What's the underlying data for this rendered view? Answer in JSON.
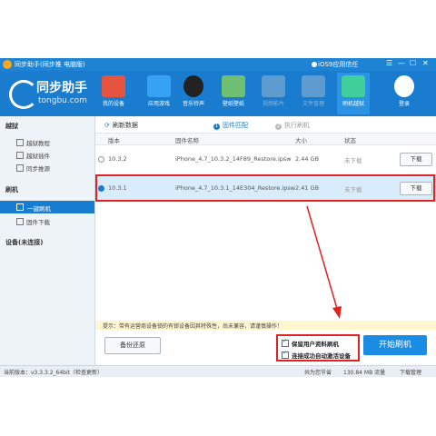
{
  "window": {
    "title": "同步助手(同步推 电脑版)",
    "ios9_link": "iOS9应用信任",
    "controls": [
      "☰",
      "—",
      "☐",
      "✕"
    ]
  },
  "brand": {
    "name_cn": "同步助手",
    "name_en": "tongbu.com"
  },
  "nav": [
    {
      "label": "我的设备",
      "icon": "store-icon",
      "color": "#e5543f",
      "active": false
    },
    {
      "label": "应用游戏",
      "icon": "app-store-icon",
      "color": "#36a3f2",
      "active": false
    },
    {
      "label": "音乐铃声",
      "icon": "music-disc-icon",
      "color": "#222222",
      "active": false
    },
    {
      "label": "壁纸壁纸",
      "icon": "wallpaper-icon",
      "color": "#6fbf73",
      "active": false
    },
    {
      "label": "视频影片",
      "icon": "video-icon",
      "color": "#8fb8dd",
      "active": false
    },
    {
      "label": "文件管理",
      "icon": "folder-icon",
      "color": "#8fb8dd",
      "active": false
    },
    {
      "label": "刷机越狱",
      "icon": "flash-icon",
      "color": "#3fcf9a",
      "active": true
    },
    {
      "label": "登录",
      "icon": "user-icon",
      "color": "#ffffff",
      "active": false
    }
  ],
  "sidebar": {
    "sections": [
      {
        "title": "越狱",
        "items": [
          "越狱教程",
          "越狱插件",
          "同步推源"
        ]
      },
      {
        "title": "刷机",
        "items": [
          "一键刷机",
          "固件下载"
        ]
      },
      {
        "title": "设备(未连接)",
        "items": []
      }
    ],
    "active_item": "一键刷机"
  },
  "toolbar": {
    "refresh_label": "刷新数据",
    "step1": "固件匹配",
    "step2": "执行刷机"
  },
  "table": {
    "columns": [
      "版本",
      "固件名称",
      "大小",
      "状态"
    ],
    "rows": [
      {
        "version": "10.3.2",
        "name": "iPhone_4.7_10.3.2_14F89_Restore.ipsw",
        "size": "2.44 GB",
        "status": "未下载",
        "action": "下载",
        "selected": false
      },
      {
        "version": "10.3.1",
        "name": "iPhone_4.7_10.3.1_14E304_Restore.ipsw",
        "size": "2.41 GB",
        "status": "未下载",
        "action": "下载",
        "selected": true
      }
    ]
  },
  "notice": "提示：带有运营商设备锁的有锁设备因其特殊性，尚未兼容，请谨慎操作！",
  "actions": {
    "backup_label": "备份还原",
    "keep_data_label": "保留用户资料刷机",
    "auto_activate_label": "连接成功自动激活设备",
    "start_label": "开始刷机"
  },
  "statusbar": {
    "version": "当前版本：v3.3.3.2_64bit（检查更新）",
    "saved": "共为您节省",
    "traffic": "130.84 MB 流量",
    "downloads": "下载管理"
  }
}
